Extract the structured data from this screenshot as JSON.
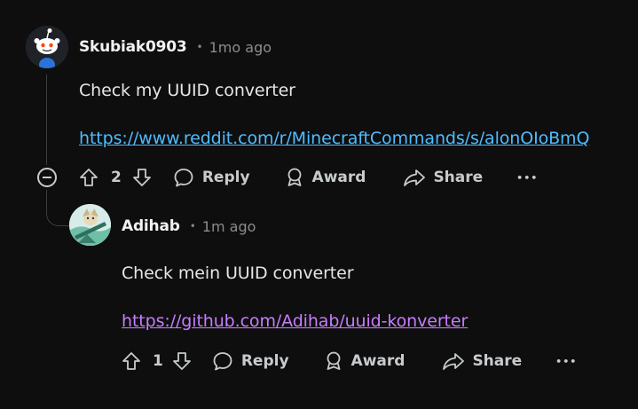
{
  "comments": [
    {
      "username": "Skubiak0903",
      "time": "1mo ago",
      "text": "Check my UUID converter",
      "link": "https://www.reddit.com/r/MinecraftCommands/s/alonOIoBmQ",
      "votes": "2"
    },
    {
      "username": "Adihab",
      "time": "1m ago",
      "text": "Check mein UUID converter",
      "link": "https://github.com/Adihab/uuid-konverter",
      "votes": "1"
    }
  ],
  "actions": {
    "reply": "Reply",
    "award": "Award",
    "share": "Share",
    "more": "•••"
  },
  "separator": "•",
  "colors": {
    "background": "#0e0e0e",
    "link_unvisited": "#4fbcff",
    "link_visited": "#c77dff",
    "thread_line": "#3a3f42"
  },
  "icons": {
    "upvote": "upvote-arrow-icon",
    "downvote": "downvote-arrow-icon",
    "reply": "speech-bubble-icon",
    "award": "award-ribbon-icon",
    "share": "share-arrow-icon",
    "more": "ellipsis-icon",
    "collapse": "minus-circle-icon"
  }
}
